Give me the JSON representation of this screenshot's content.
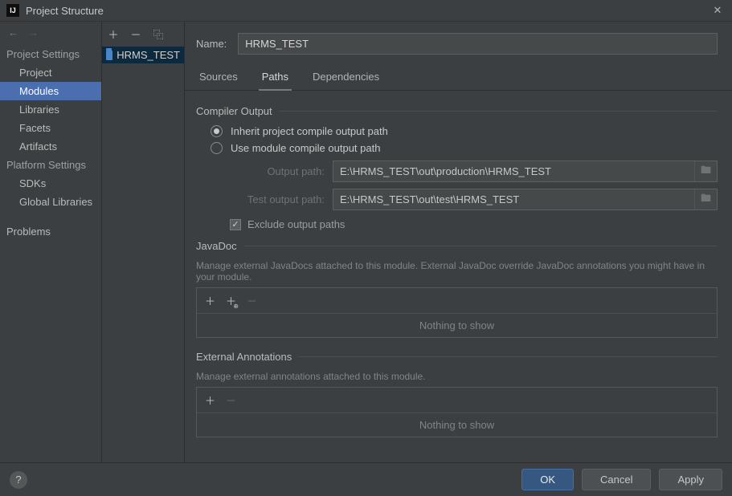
{
  "window": {
    "title": "Project Structure",
    "close_glyph": "✕"
  },
  "sidebar": {
    "back_glyph": "←",
    "forward_glyph": "→",
    "groups": [
      {
        "header": "Project Settings",
        "items": [
          {
            "label": "Project",
            "selected": false
          },
          {
            "label": "Modules",
            "selected": true
          },
          {
            "label": "Libraries",
            "selected": false
          },
          {
            "label": "Facets",
            "selected": false
          },
          {
            "label": "Artifacts",
            "selected": false
          }
        ]
      },
      {
        "header": "Platform Settings",
        "items": [
          {
            "label": "SDKs",
            "selected": false
          },
          {
            "label": "Global Libraries",
            "selected": false
          }
        ]
      },
      {
        "header": "",
        "items": [
          {
            "label": "Problems",
            "selected": false
          }
        ]
      }
    ]
  },
  "modules": {
    "add_glyph": "＋",
    "remove_glyph": "－",
    "copy_glyph": "⿻",
    "items": [
      {
        "label": "HRMS_TEST",
        "selected": true
      }
    ]
  },
  "module_panel": {
    "name_label": "Name:",
    "name_value": "HRMS_TEST",
    "tabs": [
      {
        "label": "Sources",
        "active": false
      },
      {
        "label": "Paths",
        "active": true
      },
      {
        "label": "Dependencies",
        "active": false
      }
    ],
    "compiler_output": {
      "title": "Compiler Output",
      "radio": {
        "inherit": {
          "label": "Inherit project compile output path",
          "checked": true
        },
        "use_module": {
          "label": "Use module compile output path",
          "checked": false
        }
      },
      "output_path": {
        "label": "Output path:",
        "value": "E:\\HRMS_TEST\\out\\production\\HRMS_TEST"
      },
      "test_output_path": {
        "label": "Test output path:",
        "value": "E:\\HRMS_TEST\\out\\test\\HRMS_TEST"
      },
      "exclude": {
        "label": "Exclude output paths",
        "checked": true,
        "check_glyph": "✓"
      }
    },
    "javadoc": {
      "title": "JavaDoc",
      "desc": "Manage external JavaDocs attached to this module. External JavaDoc override JavaDoc annotations you might have in your module.",
      "empty": "Nothing to show"
    },
    "external_annotations": {
      "title": "External Annotations",
      "desc": "Manage external annotations attached to this module.",
      "empty": "Nothing to show"
    }
  },
  "footer": {
    "help_glyph": "?",
    "ok": "OK",
    "cancel": "Cancel",
    "apply": "Apply"
  },
  "icons": {
    "folder_glyph": "🖿",
    "plus": "＋",
    "minus": "－"
  }
}
